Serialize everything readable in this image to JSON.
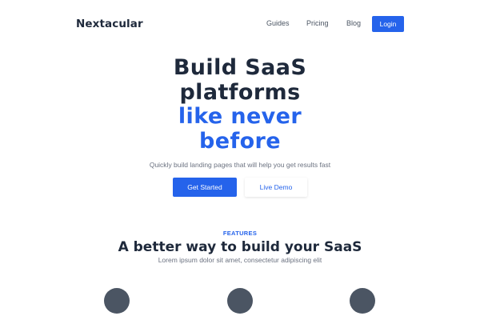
{
  "header": {
    "brand": "Nextacular",
    "nav_links": [
      "Guides",
      "Pricing",
      "Blog"
    ],
    "login_label": "Login"
  },
  "hero": {
    "title_lines": [
      "Build SaaS",
      "platforms"
    ],
    "highlight_lines": [
      "like never",
      "before"
    ],
    "subtitle": "Quickly build landing pages that will help you get results fast",
    "primary_cta": "Get Started",
    "secondary_cta": "Live Demo"
  },
  "features": {
    "label": "FEATURES",
    "title": "A better way to build your SaaS",
    "subtitle": "Lorem ipsum dolor sit amet, consectetur adipiscing elit",
    "icon_names": [
      "feature-icon-1",
      "feature-icon-2",
      "feature-icon-3"
    ]
  },
  "colors": {
    "accent": "#2563eb",
    "heading": "#1e293b",
    "muted": "#6b7280",
    "icon_circle": "#4b5563"
  }
}
